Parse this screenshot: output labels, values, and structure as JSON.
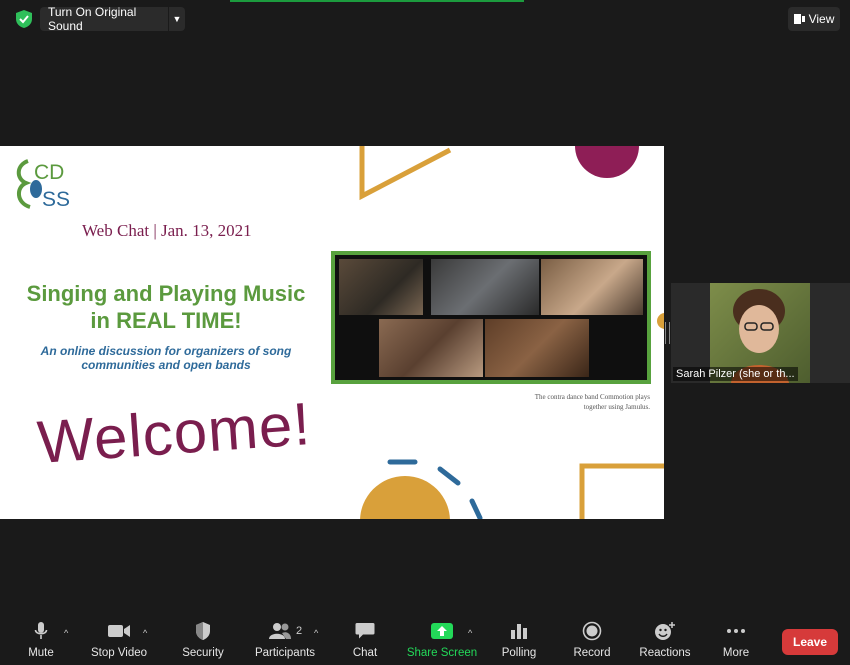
{
  "top_bar": {
    "original_sound_label": "Turn On Original Sound",
    "view_label": "View"
  },
  "slide": {
    "logo_text": "CDSS",
    "web_chat": "Web Chat | Jan. 13, 2021",
    "headline_line1": "Singing and Playing Music",
    "headline_line2": "in REAL TIME!",
    "subhead_line1": "An online discussion for organizers of song",
    "subhead_line2": "communities and open bands",
    "welcome": "Welcome!",
    "caption_line1": "The contra dance band Commotion plays",
    "caption_line2": "together using Jamulus."
  },
  "participant": {
    "name": "Sarah Pilzer (she or th..."
  },
  "toolbar": {
    "mute": "Mute",
    "stop_video": "Stop Video",
    "security": "Security",
    "participants": "Participants",
    "participants_count": "2",
    "chat": "Chat",
    "share_screen": "Share Screen",
    "polling": "Polling",
    "record": "Record",
    "reactions": "Reactions",
    "more": "More",
    "leave": "Leave"
  },
  "colors": {
    "share_green": "#23d959",
    "leave_red": "#d63a3a",
    "slide_maroon": "#7a1e4e",
    "slide_green": "#5b9a3e",
    "slide_blue": "#2e6a9a",
    "deco_gold": "#d9a03a"
  }
}
